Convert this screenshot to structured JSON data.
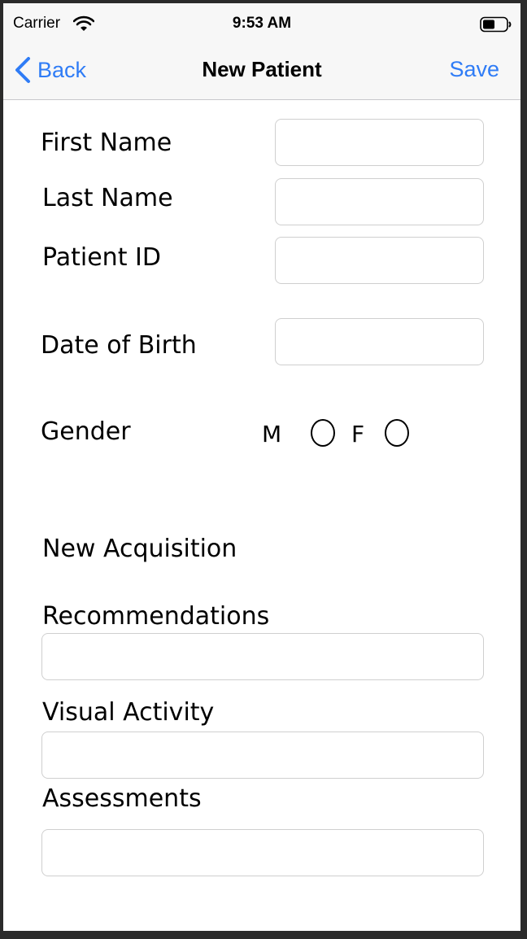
{
  "status_bar": {
    "carrier": "Carrier",
    "time": "9:53 AM",
    "wifi_icon": "wifi-icon",
    "battery_icon": "battery-icon"
  },
  "nav": {
    "back_label": "Back",
    "back_icon": "chevron-left-icon",
    "title": "New Patient",
    "save_label": "Save",
    "accent_color": "#2f7cf6"
  },
  "form": {
    "first_name": {
      "label": "First Name",
      "value": ""
    },
    "last_name": {
      "label": "Last Name",
      "value": ""
    },
    "patient_id": {
      "label": "Patient ID",
      "value": ""
    },
    "date_of_birth": {
      "label": "Date of Birth",
      "value": ""
    },
    "gender": {
      "label": "Gender",
      "option_male": "M",
      "option_female": "F",
      "selected": null
    },
    "new_acquisition": {
      "label": "New Acquisition"
    },
    "recommendations": {
      "label": "Recommendations",
      "value": ""
    },
    "visual_activity": {
      "label": "Visual Activity",
      "value": ""
    },
    "assessments": {
      "label": "Assessments",
      "value": ""
    }
  }
}
